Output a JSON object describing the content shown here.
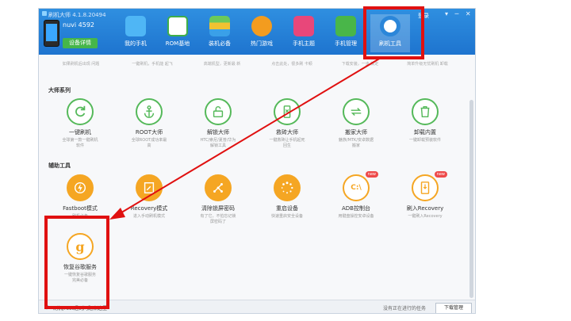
{
  "window": {
    "title": "刷机大师 4.1.8.20494",
    "login": "登录",
    "controls": "▾ ─ ✕"
  },
  "device": {
    "name": "nuvi 4592",
    "detail_button": "设备详情"
  },
  "tabs": [
    {
      "label": "我的手机",
      "icon": "cloud-icon"
    },
    {
      "label": "ROM基地",
      "icon": "rom-icon"
    },
    {
      "label": "装机必备",
      "icon": "apps-icon"
    },
    {
      "label": "热门游戏",
      "icon": "gamepad-icon"
    },
    {
      "label": "手机主题",
      "icon": "shirt-icon"
    },
    {
      "label": "手机管理",
      "icon": "phone-manage-icon"
    },
    {
      "label": "刷机工具",
      "icon": "tool-icon"
    }
  ],
  "partial_row": [
    "如果刷机后出现\n问题",
    "一键刷机，手机能\n起飞",
    "高端机型，更新最\n新",
    "点击此处，很多刷\n卡顿",
    "下载安装，一步\n搞定",
    "简单升级无忧刷机\n卸载"
  ],
  "sections": {
    "master": "大师系列",
    "aux": "辅助工具"
  },
  "master_items": [
    {
      "name": "一键刷机",
      "desc": "全球第一款一键刷机\n软件"
    },
    {
      "name": "ROOT大师",
      "desc": "全球ROOT成功率最\n高"
    },
    {
      "name": "解锁大师",
      "desc": "HTC/索尼/夏普/华为\n解锁工具"
    },
    {
      "name": "救砖大师",
      "desc": "一键救砖让手机起死\n回生"
    },
    {
      "name": "搬家大师",
      "desc": "魅族/MTK/安卓数据\n搬家"
    },
    {
      "name": "卸载内置",
      "desc": "一键卸载预装软件"
    }
  ],
  "aux_items": [
    {
      "name": "Fastboot模式",
      "desc": "刷机必备"
    },
    {
      "name": "Recovery模式",
      "desc": "进入手动刷机模式"
    },
    {
      "name": "清除锁屏密码",
      "desc": "有了它，不怕忘记锁\n屏密码了"
    },
    {
      "name": "重启设备",
      "desc": "快速重启安全设备"
    },
    {
      "name": "ADB控制台",
      "desc": "用键盘操控安卓设备",
      "badge": "new"
    },
    {
      "name": "刷入Recovery",
      "desc": "一键刷入Recovery",
      "badge": "new"
    }
  ],
  "recover_item": {
    "name": "恢复谷歌服务",
    "desc": "一键恢复谷歌服务\n完美必备"
  },
  "status": {
    "message": "刷机/root遇到问题点这里",
    "tasks": "没有正在进行的任务",
    "download_button": "下载管理"
  },
  "colors": {
    "header": "#1e74cf",
    "green": "#55b95a",
    "orange": "#f5a623",
    "highlight": "#e01010"
  }
}
